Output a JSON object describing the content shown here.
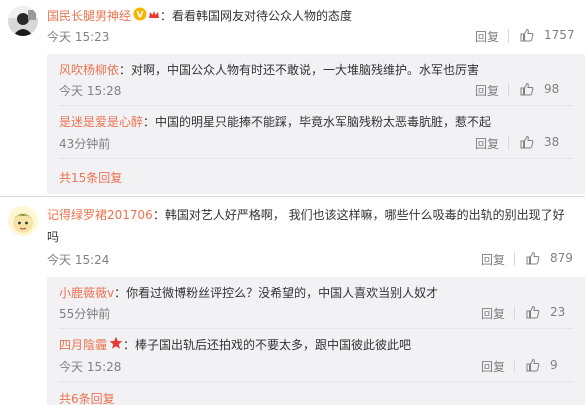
{
  "comments": [
    {
      "username": "国民长腿男神经",
      "text": "：看看韩国网友对待公众人物的态度",
      "time": "今天 15:23",
      "reply_label": "回复",
      "likes": "1757",
      "replies": [
        {
          "username": "风吹杨柳依",
          "text": "：对啊，中国公众人物有时还不敢说，一大堆脑残维护。水军也厉害",
          "time": "今天 15:28",
          "reply_label": "回复",
          "likes": "98"
        },
        {
          "username": "是迷是爱是心醉",
          "text": "：中国的明星只能捧不能踩，毕竟水军脑残粉太恶毒肮脏，惹不起",
          "time": "43分钟前",
          "reply_label": "回复",
          "likes": "38"
        }
      ],
      "more": "共15条回复"
    },
    {
      "username": "记得绿罗裙201706",
      "text_line1": "：韩国对艺人好严格啊， 我们也该这样嘛，哪些什么吸毒的出轨的别出现了好",
      "text_line2": "吗",
      "time": "今天 15:24",
      "reply_label": "回复",
      "likes": "879",
      "replies": [
        {
          "username": "小鹿薇薇v",
          "text": "：你看过微博粉丝评控么？没希望的，中国人喜欢当别人奴才",
          "time": "55分钟前",
          "reply_label": "回复",
          "likes": "23"
        },
        {
          "username": "四月陰霾",
          "text": "：棒子国出轨后还拍戏的不要太多，跟中国彼此彼此吧",
          "time": "今天 15:28",
          "reply_label": "回复",
          "likes": "9"
        }
      ],
      "more": "共6条回复"
    }
  ]
}
